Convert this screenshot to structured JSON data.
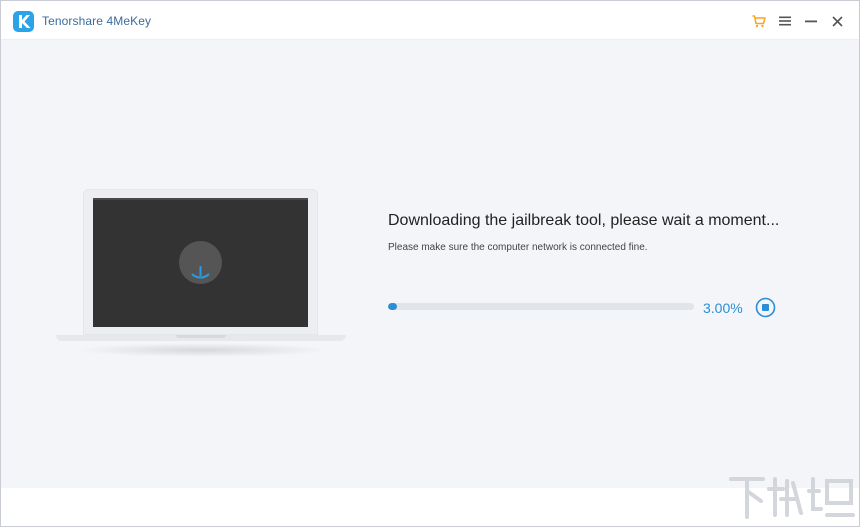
{
  "window": {
    "app_title": "Tenorshare 4MeKey",
    "icons": {
      "logo": "app-logo-k",
      "cart": "shopping-cart-icon",
      "menu": "hamburger-menu-icon",
      "minimize": "minimize-icon",
      "close": "close-icon"
    },
    "colors": {
      "cart": "#f5a623",
      "accent": "#2a8fd6",
      "logo": "#2aa3e8"
    }
  },
  "download": {
    "title": "Downloading the jailbreak tool, please wait a moment...",
    "subtitle": "Please make sure the computer network is connected fine.",
    "progress_percent": 3.0,
    "progress_label": "3.00%",
    "stop_icon": "stop-circle-icon"
  },
  "illustration": {
    "device": "laptop-icon",
    "screen_icon": "download-spinner-icon"
  }
}
